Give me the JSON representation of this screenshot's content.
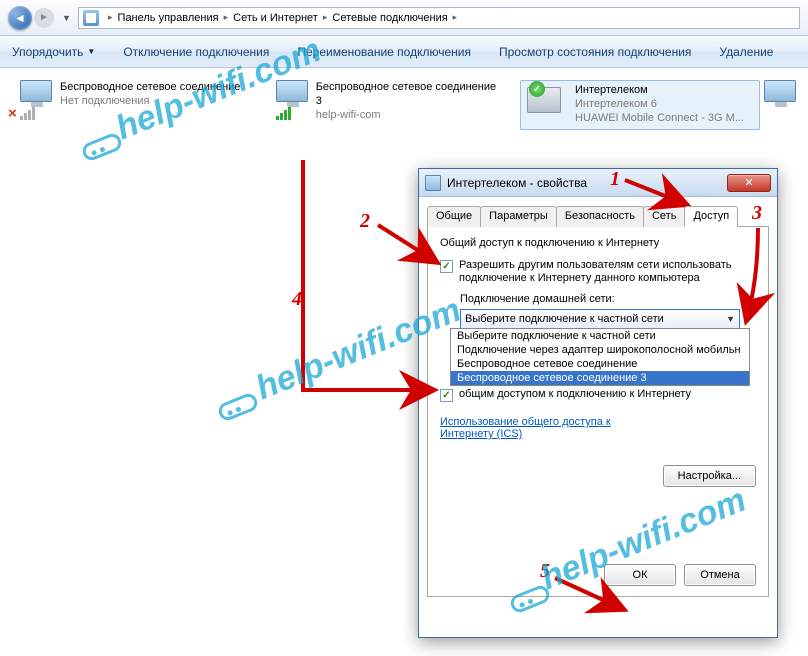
{
  "breadcrumb": {
    "p1": "Панель управления",
    "p2": "Сеть и Интернет",
    "p3": "Сетевые подключения"
  },
  "toolbar": {
    "organize": "Упорядочить",
    "disable": "Отключение подключения",
    "rename": "Переименование подключения",
    "status": "Просмотр состояния подключения",
    "delete": "Удаление"
  },
  "connections": {
    "c1": {
      "title": "Беспроводное сетевое соединение",
      "sub": "Нет подключения"
    },
    "c2": {
      "title": "Беспроводное сетевое соединение 3",
      "sub": "help-wifi-com"
    },
    "c3": {
      "title": "Интертелеком",
      "sub1": "Интертелеком 6",
      "sub2": "HUAWEI Mobile Connect - 3G M..."
    }
  },
  "dialog": {
    "title": "Интертелеком - свойства",
    "tabs": {
      "general": "Общие",
      "params": "Параметры",
      "security": "Безопасность",
      "network": "Сеть",
      "access": "Доступ"
    },
    "section": "Общий доступ к подключению к Интернету",
    "chk1": "Разрешить другим пользователям сети использовать подключение к Интернету данного компьютера",
    "homenet_label": "Подключение домашней сети:",
    "dropdown_value": "Выберите подключение к частной сети",
    "opts": {
      "o1": "Выберите подключение к частной сети",
      "o2": "Подключение через адаптер широкополосной мобильн",
      "o3": "Беспроводное сетевое соединение",
      "o4": "Беспроводное сетевое соединение 3"
    },
    "chk2_tail": "общим доступом к подключению к Интернету",
    "link": "Использование общего доступа к Интернету (ICS)",
    "settings_btn": "Настройка...",
    "ok": "ОК",
    "cancel": "Отмена"
  },
  "annotations": {
    "n1": "1",
    "n2": "2",
    "n3": "3",
    "n4": "4",
    "n5": "5"
  },
  "watermark": "help-wifi.com"
}
